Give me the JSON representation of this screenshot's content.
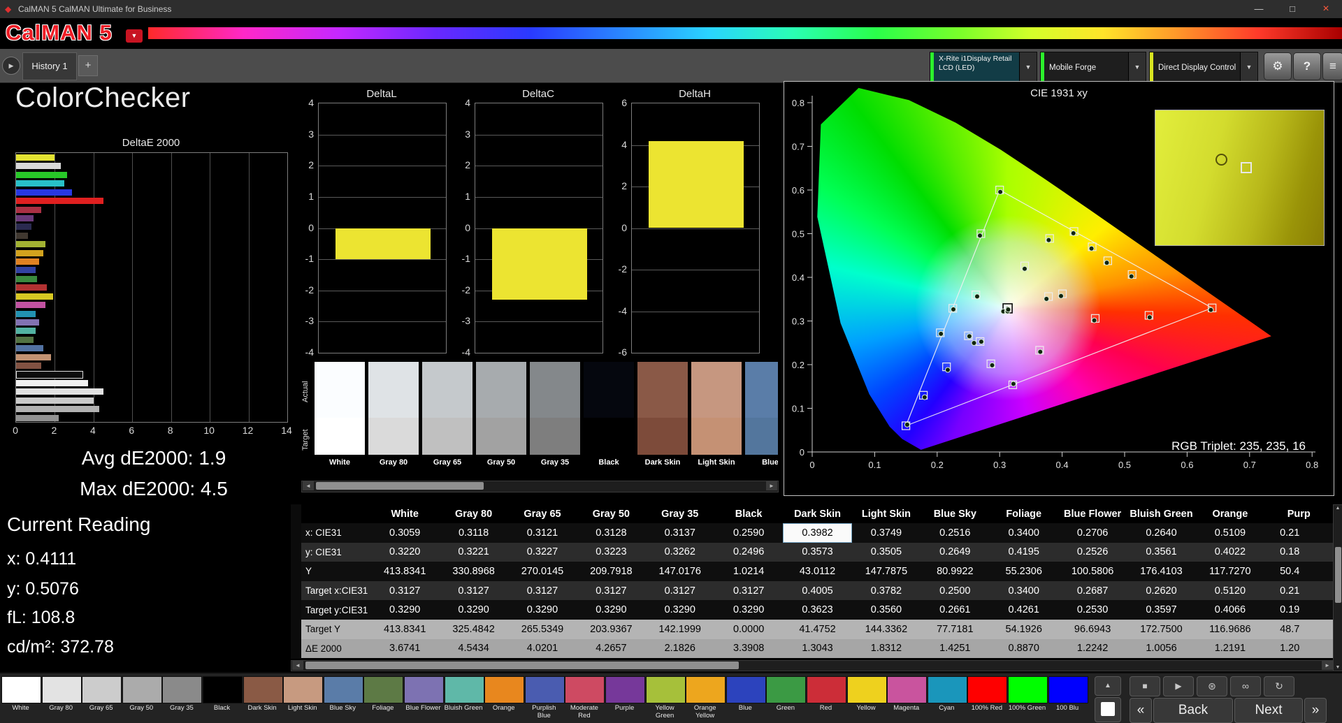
{
  "window": {
    "title": "CalMAN 5 CalMAN Ultimate for Business",
    "minimize": "—",
    "restore": "□",
    "close": "×"
  },
  "logo": {
    "text": "CalMAN 5"
  },
  "tabbar": {
    "history_tab": "History 1",
    "add_tab": "+",
    "meter_line1": "X-Rite i1Display Retail",
    "meter_line2": "LCD (LED)",
    "source": "Mobile Forge",
    "display_control": "Direct Display Control",
    "help": "?"
  },
  "left_panel": {
    "title": "ColorChecker",
    "avg": "Avg dE2000: 1.9",
    "max": "Max dE2000: 4.5",
    "reading_title": "Current Reading",
    "reading_x": "x: 0.4111",
    "reading_y": "y: 0.5076",
    "reading_fl": "fL: 108.8",
    "reading_cdm2": "cd/m²: 372.78"
  },
  "charts": {
    "deltae": {
      "type": "bar",
      "title": "DeltaE 2000",
      "xticks": [
        0,
        2,
        4,
        6,
        8,
        10,
        12,
        14
      ],
      "xmax": 14,
      "bars": [
        {
          "color": "#e2e232",
          "value": 2.0
        },
        {
          "color": "#d8d8d8",
          "value": 2.3
        },
        {
          "color": "#28c828",
          "value": 2.65
        },
        {
          "color": "#28c0c8",
          "value": 2.5
        },
        {
          "color": "#2838e0",
          "value": 2.9
        },
        {
          "color": "#e02020",
          "value": 4.5
        },
        {
          "color": "#aa3044",
          "value": 1.3
        },
        {
          "color": "#6a3a7a",
          "value": 0.9
        },
        {
          "color": "#2a2a50",
          "value": 0.8
        },
        {
          "color": "#403830",
          "value": 0.6
        },
        {
          "color": "#a2b232",
          "value": 1.5
        },
        {
          "color": "#d2a21e",
          "value": 1.4
        },
        {
          "color": "#e08222",
          "value": 1.2
        },
        {
          "color": "#3242a2",
          "value": 1.0
        },
        {
          "color": "#3a8a3e",
          "value": 1.1
        },
        {
          "color": "#b23232",
          "value": 1.6
        },
        {
          "color": "#d8c822",
          "value": 1.9
        },
        {
          "color": "#c252a2",
          "value": 1.5
        },
        {
          "color": "#2292b2",
          "value": 1.0
        },
        {
          "color": "#8272b2",
          "value": 1.2
        },
        {
          "color": "#52b2a2",
          "value": 1.0
        },
        {
          "color": "#527242",
          "value": 0.9
        },
        {
          "color": "#5272a2",
          "value": 1.4
        },
        {
          "color": "#c29272",
          "value": 1.8
        },
        {
          "color": "#825242",
          "value": 1.3
        },
        {
          "color": "#0c0c0c",
          "value": 3.4,
          "outlined": true
        },
        {
          "color": "#f2f2f2",
          "value": 3.7
        },
        {
          "color": "#e2e2e2",
          "value": 4.5
        },
        {
          "color": "#cacaca",
          "value": 4.0
        },
        {
          "color": "#b2b2b2",
          "value": 4.3
        },
        {
          "color": "#929292",
          "value": 2.2
        }
      ]
    },
    "deltal": {
      "type": "bar",
      "title": "DeltaL",
      "ticks": [
        4,
        3,
        2,
        1,
        0,
        -1,
        -2,
        -3,
        -4
      ],
      "range": 4,
      "value": -1.0,
      "bar_color": "#ece431"
    },
    "deltac": {
      "type": "bar",
      "title": "DeltaC",
      "ticks": [
        4,
        3,
        2,
        1,
        0,
        -1,
        -2,
        -3,
        -4
      ],
      "range": 4,
      "value": -2.3,
      "bar_color": "#ece431"
    },
    "deltah": {
      "type": "bar",
      "title": "DeltaH",
      "ticks": [
        6,
        4,
        2,
        0,
        -2,
        -4,
        -6
      ],
      "range": 6,
      "value": 4.2,
      "bar_color": "#ece431"
    },
    "cie": {
      "type": "scatter",
      "title": "CIE 1931 xy",
      "rgb_triplet": "RGB Triplet: 235, 235, 16",
      "xticks": [
        0,
        0.1,
        0.2,
        0.3,
        0.4,
        0.5,
        0.6,
        0.7,
        0.8
      ],
      "yticks": [
        0,
        0.1,
        0.2,
        0.3,
        0.4,
        0.5,
        0.6,
        0.7,
        0.8
      ],
      "triangle": [
        [
          0.64,
          0.33
        ],
        [
          0.3,
          0.6
        ],
        [
          0.15,
          0.06
        ]
      ],
      "gray_target": [
        0.3127,
        0.329
      ],
      "gray_measured": [
        [
          0.3059,
          0.322
        ],
        [
          0.3118,
          0.3221
        ],
        [
          0.3121,
          0.3227
        ],
        [
          0.3128,
          0.3223
        ],
        [
          0.3137,
          0.3262
        ],
        [
          0.259,
          0.2496
        ]
      ],
      "points": [
        {
          "t": [
            0.4005,
            0.3623
          ],
          "m": [
            0.3982,
            0.3573
          ]
        },
        {
          "t": [
            0.3782,
            0.356
          ],
          "m": [
            0.3749,
            0.3505
          ]
        },
        {
          "t": [
            0.25,
            0.2661
          ],
          "m": [
            0.2516,
            0.2649
          ]
        },
        {
          "t": [
            0.34,
            0.4261
          ],
          "m": [
            0.34,
            0.4195
          ]
        },
        {
          "t": [
            0.2687,
            0.253
          ],
          "m": [
            0.2706,
            0.2526
          ]
        },
        {
          "t": [
            0.262,
            0.3597
          ],
          "m": [
            0.264,
            0.3561
          ]
        },
        {
          "t": [
            0.512,
            0.4066
          ],
          "m": [
            0.5109,
            0.4022
          ]
        },
        {
          "t": [
            0.215,
            0.195
          ],
          "m": [
            0.217,
            0.188
          ]
        },
        {
          "t": [
            0.453,
            0.306
          ],
          "m": [
            0.4515,
            0.3015
          ]
        },
        {
          "t": [
            0.286,
            0.202
          ],
          "m": [
            0.288,
            0.1985
          ]
        },
        {
          "t": [
            0.38,
            0.489
          ],
          "m": [
            0.3785,
            0.4855
          ]
        },
        {
          "t": [
            0.473,
            0.438
          ],
          "m": [
            0.4715,
            0.4335
          ]
        },
        {
          "t": [
            0.178,
            0.13
          ],
          "m": [
            0.18,
            0.1255
          ]
        },
        {
          "t": [
            0.27,
            0.5
          ],
          "m": [
            0.2685,
            0.4955
          ]
        },
        {
          "t": [
            0.539,
            0.313
          ],
          "m": [
            0.54,
            0.3085
          ]
        },
        {
          "t": [
            0.448,
            0.47
          ],
          "m": [
            0.447,
            0.466
          ]
        },
        {
          "t": [
            0.364,
            0.233
          ],
          "m": [
            0.365,
            0.2295
          ]
        },
        {
          "t": [
            0.205,
            0.273
          ],
          "m": [
            0.206,
            0.2705
          ]
        },
        {
          "t": [
            0.64,
            0.33
          ],
          "m": [
            0.638,
            0.3255
          ]
        },
        {
          "t": [
            0.3,
            0.6
          ],
          "m": [
            0.301,
            0.5955
          ]
        },
        {
          "t": [
            0.15,
            0.06
          ],
          "m": [
            0.152,
            0.0625
          ]
        },
        {
          "t": [
            0.419,
            0.505
          ],
          "m": [
            0.418,
            0.501
          ]
        },
        {
          "t": [
            0.225,
            0.329
          ],
          "m": [
            0.226,
            0.3265
          ]
        },
        {
          "t": [
            0.321,
            0.154
          ],
          "m": [
            0.322,
            0.156
          ]
        }
      ]
    }
  },
  "swatch_strip": {
    "row_labels": [
      "Actual",
      "Target"
    ],
    "patches": [
      {
        "label": "White",
        "actual": "#fbfdff",
        "target": "#ffffff"
      },
      {
        "label": "Gray 80",
        "actual": "#dfe3e6",
        "target": "#dadada"
      },
      {
        "label": "Gray 65",
        "actual": "#c5c9cc",
        "target": "#c0c0c0"
      },
      {
        "label": "Gray 50",
        "actual": "#a7abae",
        "target": "#a2a2a2"
      },
      {
        "label": "Gray 35",
        "actual": "#84888b",
        "target": "#7e7e7e"
      },
      {
        "label": "Black",
        "actual": "#05070e",
        "target": "#000000"
      },
      {
        "label": "Dark Skin",
        "actual": "#8a5947",
        "target": "#7d4b3a"
      },
      {
        "label": "Light Skin",
        "actual": "#c69780",
        "target": "#c59174"
      },
      {
        "label": "Blue",
        "actual": "#5a7da8",
        "target": "#53769d"
      }
    ]
  },
  "table": {
    "columns": [
      "White",
      "Gray 80",
      "Gray 65",
      "Gray 50",
      "Gray 35",
      "Black",
      "Dark Skin",
      "Light Skin",
      "Blue Sky",
      "Foliage",
      "Blue Flower",
      "Bluish Green",
      "Orange",
      "Purp"
    ],
    "rows": [
      {
        "label": "x: CIE31",
        "values": [
          "0.3059",
          "0.3118",
          "0.3121",
          "0.3128",
          "0.3137",
          "0.2590",
          "0.3982",
          "0.3749",
          "0.2516",
          "0.3400",
          "0.2706",
          "0.2640",
          "0.5109",
          "0.21"
        ]
      },
      {
        "label": "y: CIE31",
        "values": [
          "0.3220",
          "0.3221",
          "0.3227",
          "0.3223",
          "0.3262",
          "0.2496",
          "0.3573",
          "0.3505",
          "0.2649",
          "0.4195",
          "0.2526",
          "0.3561",
          "0.4022",
          "0.18"
        ]
      },
      {
        "label": "Y",
        "values": [
          "413.8341",
          "330.8968",
          "270.0145",
          "209.7918",
          "147.0176",
          "1.0214",
          "43.0112",
          "147.7875",
          "80.9922",
          "55.2306",
          "100.5806",
          "176.4103",
          "117.7270",
          "50.4"
        ]
      },
      {
        "label": "Target x:CIE31",
        "values": [
          "0.3127",
          "0.3127",
          "0.3127",
          "0.3127",
          "0.3127",
          "0.3127",
          "0.4005",
          "0.3782",
          "0.2500",
          "0.3400",
          "0.2687",
          "0.2620",
          "0.5120",
          "0.21"
        ]
      },
      {
        "label": "Target y:CIE31",
        "values": [
          "0.3290",
          "0.3290",
          "0.3290",
          "0.3290",
          "0.3290",
          "0.3290",
          "0.3623",
          "0.3560",
          "0.2661",
          "0.4261",
          "0.2530",
          "0.3597",
          "0.4066",
          "0.19"
        ]
      },
      {
        "label": "Target Y",
        "values": [
          "413.8341",
          "325.4842",
          "265.5349",
          "203.9367",
          "142.1999",
          "0.0000",
          "41.4752",
          "144.3362",
          "77.7181",
          "54.1926",
          "96.6943",
          "172.7500",
          "116.9686",
          "48.7"
        ]
      },
      {
        "label": "ΔE 2000",
        "values": [
          "3.6741",
          "4.5434",
          "4.0201",
          "4.2657",
          "2.1826",
          "3.3908",
          "1.3043",
          "1.8312",
          "1.4251",
          "0.8870",
          "1.2242",
          "1.0056",
          "1.2191",
          "1.20"
        ]
      }
    ],
    "selected_cell": {
      "row": 0,
      "col": 6
    }
  },
  "patch_bar": {
    "patches": [
      {
        "label": "White",
        "color": "#ffffff"
      },
      {
        "label": "Gray 80",
        "color": "#e3e3e3"
      },
      {
        "label": "Gray 65",
        "color": "#cccccc"
      },
      {
        "label": "Gray 50",
        "color": "#ababab"
      },
      {
        "label": "Gray 35",
        "color": "#8a8a8a"
      },
      {
        "label": "Black",
        "color": "#000000"
      },
      {
        "label": "Dark Skin",
        "color": "#8a5a45"
      },
      {
        "label": "Light Skin",
        "color": "#c79a80"
      },
      {
        "label": "Blue Sky",
        "color": "#5a7ca8"
      },
      {
        "label": "Foliage",
        "color": "#5d7a45"
      },
      {
        "label": "Blue Flower",
        "color": "#7d72b2"
      },
      {
        "label": "Bluish Green",
        "color": "#5fb8a8"
      },
      {
        "label": "Orange",
        "color": "#e8871e"
      },
      {
        "label": "Purplish Blue",
        "color": "#4a5cb0"
      },
      {
        "label": "Moderate Red",
        "color": "#ce4a62"
      },
      {
        "label": "Purple",
        "color": "#76389a"
      },
      {
        "label": "Yellow Green",
        "color": "#a6c03a"
      },
      {
        "label": "Orange Yellow",
        "color": "#eda61e"
      },
      {
        "label": "Blue",
        "color": "#2c43bd"
      },
      {
        "label": "Green",
        "color": "#3b9a44"
      },
      {
        "label": "Red",
        "color": "#cc2d38"
      },
      {
        "label": "Yellow",
        "color": "#eed11e"
      },
      {
        "label": "Magenta",
        "color": "#c9549e"
      },
      {
        "label": "Cyan",
        "color": "#1a96bb"
      },
      {
        "label": "100% Red",
        "color": "#fe0000"
      },
      {
        "label": "100% Green",
        "color": "#00fe00"
      },
      {
        "label": "100 Blu",
        "color": "#0000fe"
      }
    ]
  },
  "controls": {
    "back": "Back",
    "next": "Next"
  }
}
